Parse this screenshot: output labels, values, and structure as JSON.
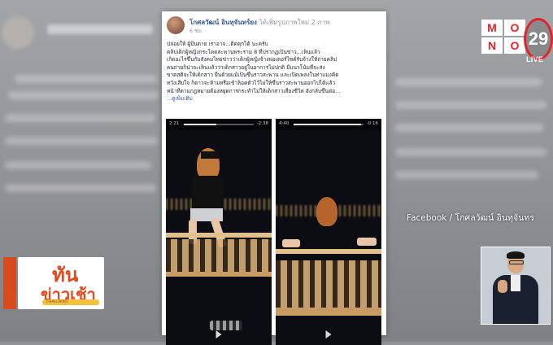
{
  "post": {
    "author": "โกศลวัฒน์ อินทุจันทร์ยง",
    "action": "ได้เพิ่มรูปภาพใหม่ 2 ภาพ",
    "time": "6 ชม. ·",
    "lines": [
      "ปล่อยให้ ผู้ป้นตาย เราอาจ...ติดคุกได้ นะครับ",
      "คลิปเด็กผู้หญิงกระโดดสะพานพระราม 8 ที่ปรากฏเป็นข่าว...เห็นแล้ว",
      "เกิดอะไรขึ้นกับสังคมไทยข่าวว่าเด็กผู้หญิงจ้างพ่อเตอร์ไซค์รับจ้างให้ถ่ายคลิป",
      "คนถ่ายก็น่าจะเห็นแล้วว่าเด็กสาวอยู่ในอาการไม่ปกติ มีแนวโน้มที่จะส่ง",
      "ขาดสติจะให้เด็กสาว ยืนด้วยแม้เป็นขึ้นราวสะพาน และเปิดเพลงในท่าแมงคิด",
      "หวังเสียใจ ก็ดาวจะห้ามหรือเข้าล็อคตัวไว้ไม่ให้ขึ้นราวสะพานออกไปได้แล้ว",
      "หน้าที่ตามกฎหมายต้องหยุดการกระทำไม่ให้เด็กสาวเสี่ยงชีวิต ฮังกลับขึ้นต่อ...",
      "...ดูเพิ่มเติม"
    ]
  },
  "videos": [
    {
      "start": "2:21",
      "end": "-2:38",
      "progress": 0.47
    },
    {
      "start": "4:40",
      "end": "-0:16",
      "progress": 0.97
    }
  ],
  "source_caption": "Facebook / โกศลวัฒน์ อินทุจันทร",
  "logo": {
    "letters": [
      "M",
      "O",
      "N",
      "O"
    ],
    "number": "29",
    "live": "LIVE"
  },
  "program": {
    "top": "ทัน",
    "bottom": "ข่าวเช้า",
    "strip": "THAILAND"
  },
  "colors": {
    "brand_red": "#e3242b",
    "program_orange": "#e24a1b",
    "link_blue": "#365899"
  }
}
